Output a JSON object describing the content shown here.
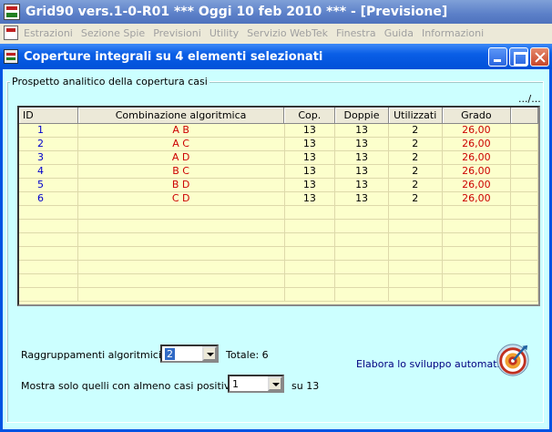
{
  "app": {
    "title": "Grid90 vers.1-0-R01  ***  Oggi 10 feb 2010  ***   - [Previsione]"
  },
  "menu": {
    "items": [
      "Estrazioni",
      "Sezione Spie",
      "Previsioni",
      "Utility",
      "Servizio WebTek",
      "Finestra",
      "Guida",
      "Informazioni"
    ]
  },
  "window": {
    "title": "Coperture integrali su 4 elementi selezionati"
  },
  "group": {
    "title": "Prospetto analitico della copertura casi",
    "more": ".../..."
  },
  "table": {
    "headers": {
      "id": "ID",
      "comb": "Combinazione algoritmica",
      "cop": "Cop.",
      "doppie": "Doppie",
      "utilizzati": "Utilizzati",
      "grado": "Grado"
    },
    "rows": [
      {
        "id": "1",
        "comb": "A B",
        "cop": "13",
        "doppie": "13",
        "utilizzati": "2",
        "grado": "26,00"
      },
      {
        "id": "2",
        "comb": "A C",
        "cop": "13",
        "doppie": "13",
        "utilizzati": "2",
        "grado": "26,00"
      },
      {
        "id": "3",
        "comb": "A D",
        "cop": "13",
        "doppie": "13",
        "utilizzati": "2",
        "grado": "26,00"
      },
      {
        "id": "4",
        "comb": "B C",
        "cop": "13",
        "doppie": "13",
        "utilizzati": "2",
        "grado": "26,00"
      },
      {
        "id": "5",
        "comb": "B D",
        "cop": "13",
        "doppie": "13",
        "utilizzati": "2",
        "grado": "26,00"
      },
      {
        "id": "6",
        "comb": "C D",
        "cop": "13",
        "doppie": "13",
        "utilizzati": "2",
        "grado": "26,00"
      }
    ],
    "empty_rows": 7
  },
  "controls": {
    "raggruppamenti_label": "Raggruppamenti algoritmici da",
    "raggruppamenti_value": "2",
    "totale_label": "Totale: 6",
    "mostra_label": "Mostra solo quelli con almeno casi positivi",
    "mostra_value": "1",
    "su_label": "su 13",
    "elabora_label": "Elabora lo sviluppo automatico",
    "elabora_icon": "target-icon"
  },
  "colors": {
    "client_bg": "#ccffff",
    "grid_bg": "#fcffcc",
    "id_color": "#0000cc",
    "red_text": "#cc0000"
  }
}
